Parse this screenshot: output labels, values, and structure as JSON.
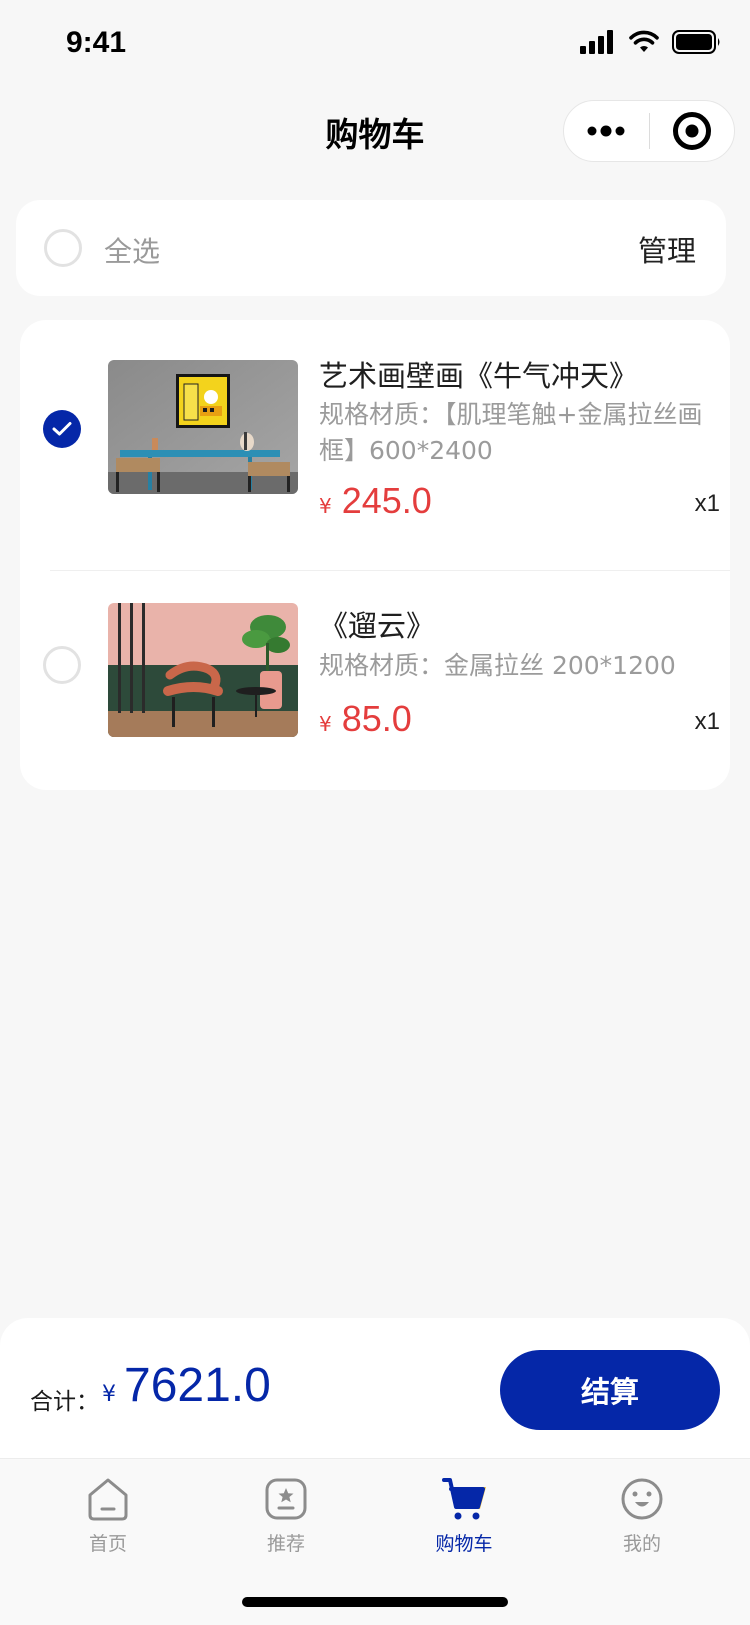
{
  "status_bar": {
    "time": "9:41"
  },
  "nav": {
    "title": "购物车",
    "capsule": {
      "more_icon": "more-dots-icon",
      "close_icon": "target-circle-icon"
    }
  },
  "select_all": {
    "label": "全选",
    "checked": false,
    "manage_label": "管理"
  },
  "cart_items": [
    {
      "checked": true,
      "title": "艺术画壁画《牛气冲天》",
      "spec": "规格材质：【肌理笔触+金属拉丝画框】600*2400",
      "currency": "¥",
      "price": "245.0",
      "quantity": "x1"
    },
    {
      "checked": false,
      "title": "《遛云》",
      "spec": "规格材质：金属拉丝 200*1200",
      "currency": "¥",
      "price": "85.0",
      "quantity": "x1"
    }
  ],
  "checkout": {
    "total_label": "合计：",
    "currency": "¥",
    "total": "7621.0",
    "button_label": "结算"
  },
  "tabs": [
    {
      "label": "首页",
      "icon": "home-icon",
      "active": false
    },
    {
      "label": "推荐",
      "icon": "star-box-icon",
      "active": false
    },
    {
      "label": "购物车",
      "icon": "cart-icon",
      "active": true
    },
    {
      "label": "我的",
      "icon": "smiley-face-icon",
      "active": false
    }
  ],
  "colors": {
    "brand": "#0527a8",
    "price_red": "#e43d3d",
    "background": "#f7f7f7",
    "tab_active_accent": "#f6c437"
  }
}
